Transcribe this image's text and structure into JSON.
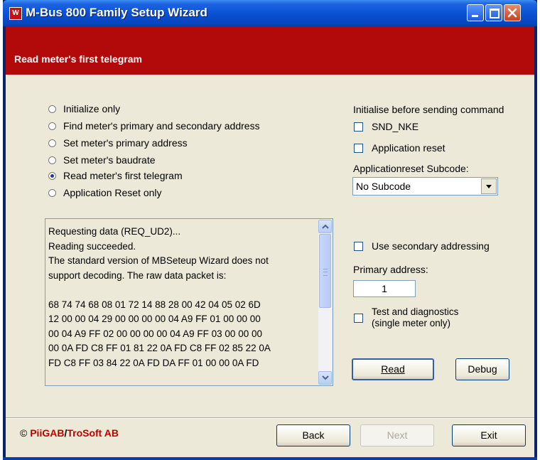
{
  "window": {
    "title": "M-Bus 800 Family Setup Wizard",
    "icon_letter": "W"
  },
  "banner": {
    "title": "Read meter's first telegram"
  },
  "options": [
    {
      "label": "Initialize only",
      "selected": false
    },
    {
      "label": "Find meter's primary and secondary address",
      "selected": false
    },
    {
      "label": "Set meter's primary address",
      "selected": false
    },
    {
      "label": "Set meter's baudrate",
      "selected": false
    },
    {
      "label": "Read meter's first telegram",
      "selected": true
    },
    {
      "label": "Application Reset only",
      "selected": false
    }
  ],
  "init": {
    "heading": "Initialise before sending command",
    "snd_nke": "SND_NKE",
    "app_reset": "Application reset",
    "subcode_label": "Applicationreset Subcode:",
    "subcode_value": "No Subcode"
  },
  "log": {
    "lines": [
      "Requesting data (REQ_UD2)...",
      "Reading succeeded.",
      "The standard version of MBSeteup Wizard does not",
      "support decoding. The raw data packet is:",
      "",
      "68 74 74 68 08 01 72 14 88 28 00 42 04 05 02 6D",
      "12 00 00 04 29 00 00 00 00 04 A9 FF 01 00 00 00",
      "00 04 A9 FF 02 00 00 00 00 04 A9 FF 03 00 00 00",
      "00 0A FD C8 FF 01 81 22 0A FD C8 FF 02 85 22 0A",
      "FD C8 FF 03 84 22 0A FD DA FF 01 00 00 0A FD"
    ]
  },
  "secondary": {
    "use_secondary": "Use secondary addressing",
    "primary_label": "Primary address:",
    "primary_value": "1",
    "test_line1": "Test and diagnostics",
    "test_line2": "(single meter only)"
  },
  "buttons": {
    "read": "Read",
    "debug": "Debug",
    "back": "Back",
    "next": "Next",
    "exit": "Exit"
  },
  "footer": {
    "copyright_symbol": "©",
    "brand1": "PiiGAB",
    "slash": "/",
    "brand2": "TroSoft AB"
  },
  "colors": {
    "banner": "#b20a0a",
    "titlebar": "#0a52d6",
    "dialog_bg": "#ece9d8",
    "brand_red": "#c00000"
  }
}
